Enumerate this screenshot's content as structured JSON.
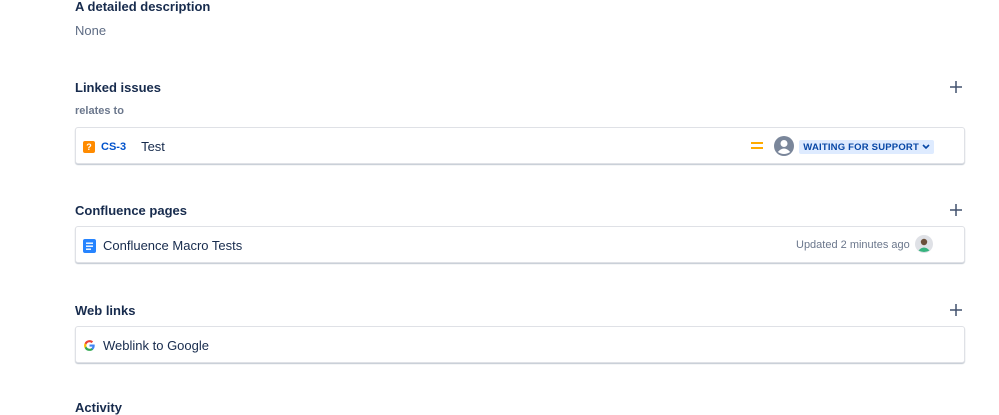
{
  "description": {
    "heading": "A detailed description",
    "value": "None"
  },
  "linked_issues": {
    "heading": "Linked issues",
    "relation": "relates to",
    "items": [
      {
        "type_icon": "question-type-icon",
        "key": "CS-3",
        "summary": "Test",
        "priority_icon": "priority-medium-icon",
        "assignee_icon": "unassigned-avatar-icon",
        "status": "WAITING FOR SUPPORT"
      }
    ]
  },
  "confluence_pages": {
    "heading": "Confluence pages",
    "items": [
      {
        "icon": "confluence-page-icon",
        "title": "Confluence Macro Tests",
        "updated": "Updated 2 minutes ago",
        "avatar_icon": "user-avatar-icon"
      }
    ]
  },
  "web_links": {
    "heading": "Web links",
    "items": [
      {
        "icon": "google-icon",
        "title": "Weblink to Google"
      }
    ]
  },
  "activity": {
    "heading": "Activity"
  },
  "colors": {
    "link": "#0052cc",
    "status_bg": "#deebff",
    "status_text": "#0747a6",
    "priority": "#ffab00",
    "question_icon": "#ff8b00",
    "confluence_icon": "#2684ff"
  }
}
